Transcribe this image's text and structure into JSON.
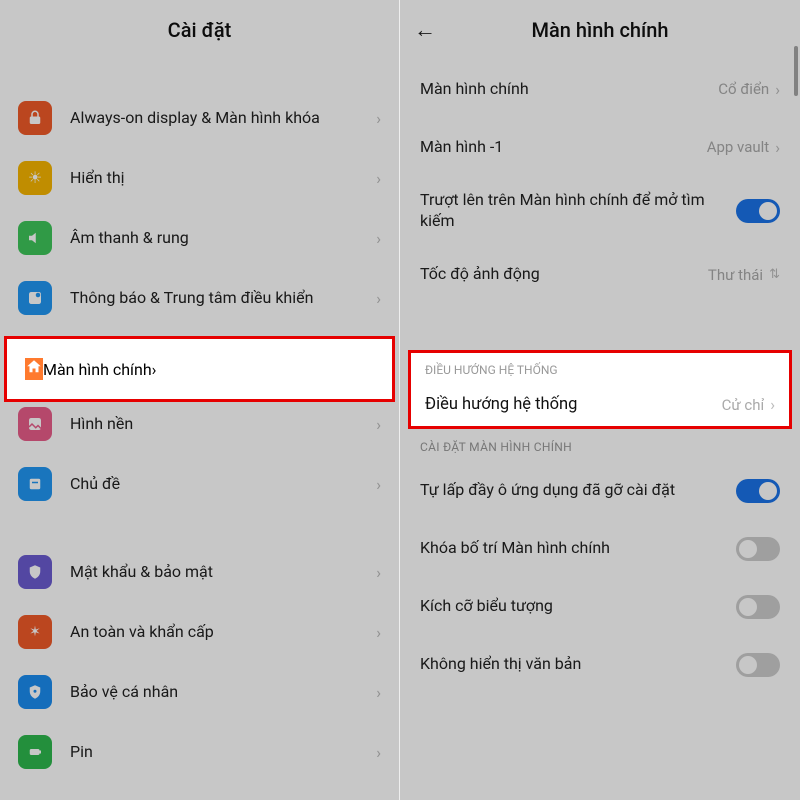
{
  "left": {
    "title": "Cài đặt",
    "items": [
      {
        "id": "aod",
        "label": "Always-on display & Màn hình khóa",
        "icon": "lock-icon",
        "iconClass": "ic-red"
      },
      {
        "id": "display",
        "label": "Hiển thị",
        "icon": "sun-icon",
        "iconClass": "ic-yellow"
      },
      {
        "id": "sound",
        "label": "Âm thanh & rung",
        "icon": "speaker-icon",
        "iconClass": "ic-green"
      },
      {
        "id": "notify",
        "label": "Thông báo & Trung tâm điều khiển",
        "icon": "notify-icon",
        "iconClass": "ic-blue1"
      },
      {
        "id": "home",
        "label": "Màn hình chính",
        "icon": "home-icon",
        "iconClass": "ic-orange",
        "highlighted": true
      },
      {
        "id": "wallpaper",
        "label": "Hình nền",
        "icon": "wallpaper-icon",
        "iconClass": "ic-pink"
      },
      {
        "id": "themes",
        "label": "Chủ đề",
        "icon": "theme-icon",
        "iconClass": "ic-blue2"
      }
    ],
    "items2": [
      {
        "id": "security",
        "label": "Mật khẩu & bảo mật",
        "icon": "shield-icon",
        "iconClass": "ic-purple"
      },
      {
        "id": "emergency",
        "label": "An toàn và khẩn cấp",
        "icon": "emergency-icon",
        "iconClass": "ic-red2"
      },
      {
        "id": "privacy",
        "label": "Bảo vệ cá nhân",
        "icon": "privacy-icon",
        "iconClass": "ic-blue3"
      },
      {
        "id": "battery",
        "label": "Pin",
        "icon": "battery-icon",
        "iconClass": "ic-green2"
      }
    ]
  },
  "right": {
    "title": "Màn hình chính",
    "rows_top": [
      {
        "id": "hs-style",
        "label": "Màn hình chính",
        "value": "Cổ điển",
        "type": "value"
      },
      {
        "id": "hs-minus1",
        "label": "Màn hình -1",
        "value": "App vault",
        "type": "value"
      },
      {
        "id": "hs-swipe",
        "label": "Trượt lên trên Màn hình chính để mở tìm kiếm",
        "type": "toggle",
        "on": true
      },
      {
        "id": "hs-anim",
        "label": "Tốc độ ảnh động",
        "value": "Thư thái",
        "type": "picker"
      }
    ],
    "nav_section": {
      "heading": "ĐIỀU HƯỚNG HỆ THỐNG",
      "row": {
        "id": "sysnav",
        "label": "Điều hướng hệ thống",
        "value": "Cử chỉ"
      }
    },
    "hs_settings": {
      "heading": "CÀI ĐẶT MÀN HÌNH CHÍNH",
      "rows": [
        {
          "id": "autofill",
          "label": "Tự lấp đầy ô ứng dụng đã gỡ cài đặt",
          "type": "toggle",
          "on": true
        },
        {
          "id": "lock",
          "label": "Khóa bố trí Màn hình chính",
          "type": "toggle",
          "on": false
        },
        {
          "id": "iconsize",
          "label": "Kích cỡ biểu tượng",
          "type": "toggle",
          "on": false
        },
        {
          "id": "notext",
          "label": "Không hiển thị văn bản",
          "type": "toggle",
          "on": false
        }
      ]
    }
  }
}
